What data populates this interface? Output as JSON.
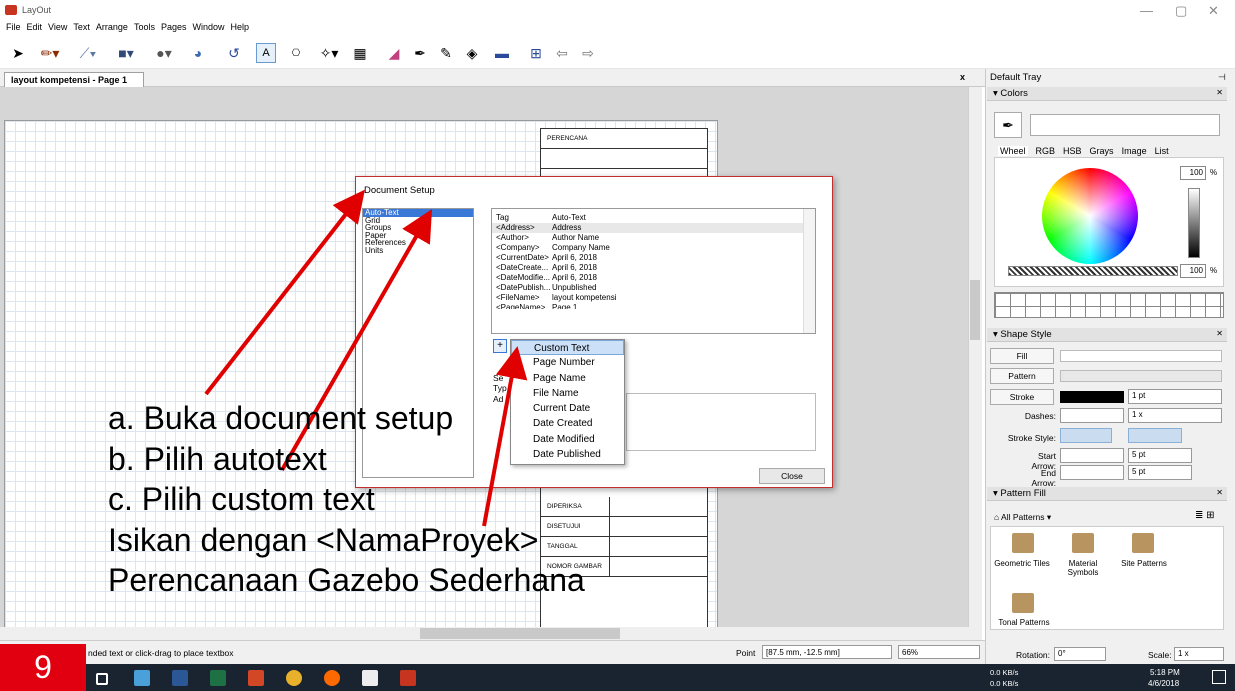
{
  "window": {
    "title": "LayOut",
    "min_icon": "minimize-icon",
    "max_icon": "maximize-icon",
    "close_icon": "close-icon"
  },
  "menu": [
    "File",
    "Edit",
    "View",
    "Text",
    "Arrange",
    "Tools",
    "Pages",
    "Window",
    "Help"
  ],
  "toolbar_icons": [
    "select-arrow-icon",
    "pencil-icon",
    "line-icon",
    "rectangle-icon",
    "circle-icon",
    "pie-icon",
    "freehand-icon",
    "text-icon",
    "label-icon",
    "dimension-icon",
    "table-icon",
    "eraser-icon",
    "eyedropper-icon",
    "pen-icon",
    "paint-bucket-icon",
    "presentation-icon",
    "add-page-icon",
    "prev-page-icon",
    "next-page-icon"
  ],
  "tab": {
    "label": "layout kompetensi - Page 1",
    "close": "x"
  },
  "titleblock": {
    "rows": [
      "PERENCANA",
      "DIPERIKSA",
      "DISETUJUI",
      "TANGGAL",
      "NOMOR GAMBAR"
    ]
  },
  "status": {
    "hint": "nded text or click-drag to place textbox",
    "point_label": "Point",
    "point_value": "[87.5 mm, -12.5 mm]",
    "zoom": "66%"
  },
  "tray": {
    "title": "Default Tray",
    "colors": {
      "header": "Colors",
      "tabs": [
        "Wheel",
        "RGB",
        "HSB",
        "Grays",
        "Image",
        "List"
      ],
      "brightness": "100",
      "opacity": "100",
      "percent": "%"
    },
    "shape_style": {
      "header": "Shape Style",
      "fill": "Fill",
      "pattern": "Pattern",
      "stroke": "Stroke",
      "stroke_width": "1 pt",
      "dashes_label": "Dashes:",
      "dashes_scale": "1 x",
      "stroke_style_label": "Stroke Style:",
      "start_arrow_label": "Start Arrow:",
      "start_arrow_size": "5 pt",
      "end_arrow_label": "End Arrow:",
      "end_arrow_size": "5 pt"
    },
    "pattern_fill": {
      "header": "Pattern Fill",
      "dropdown": "All Patterns",
      "items": [
        "Geometric Tiles",
        "Material Symbols",
        "Site Patterns",
        "Tonal Patterns"
      ]
    },
    "rotation_label": "Rotation:",
    "rotation_value": "0°",
    "scale_label": "Scale:",
    "scale_value": "1 x"
  },
  "dialog": {
    "title": "Document Setup",
    "nav": [
      "Auto-Text",
      "Grid",
      "Groups",
      "Paper",
      "References",
      "Units"
    ],
    "table_header": [
      "Tag",
      "Auto-Text"
    ],
    "table_rows": [
      [
        "<Address>",
        "Address"
      ],
      [
        "<Author>",
        "Author Name"
      ],
      [
        "<Company>",
        "Company Name"
      ],
      [
        "<CurrentDate>",
        "April 6, 2018"
      ],
      [
        "<DateCreate...",
        "April 6, 2018"
      ],
      [
        "<DateModifie...",
        "April 6, 2018"
      ],
      [
        "<DatePublish...",
        "Unpublished"
      ],
      [
        "<FileName>",
        "layout kompetensi"
      ],
      [
        "<PageName>",
        "Page 1"
      ]
    ],
    "add_btn": "+",
    "side_text": [
      "Se",
      "Typ",
      "Ad"
    ],
    "close_btn": "Close"
  },
  "add_menu": [
    "Custom Text",
    "Page Number",
    "Page Name",
    "File Name",
    "Current Date",
    "Date Created",
    "Date Modified",
    "Date Published"
  ],
  "overlay": {
    "a": "a.   Buka document setup",
    "b": "b.   Pilih autotext",
    "c": "c.   Pilih custom text",
    "line4": "Isikan dengan <NamaProyek>",
    "line5": "Perencanaan Gazebo Sederhana"
  },
  "slide_number": "9",
  "taskbar": {
    "net_up": "0.0 KB/s",
    "net_down": "0.0 KB/s",
    "time": "5:18 PM",
    "date": "4/6/2018"
  },
  "colors": {
    "arrow_red": "#e00000",
    "badge_red": "#e0000f",
    "selection_blue": "#3a78d8",
    "menu_highlight": "#cce0f7"
  }
}
